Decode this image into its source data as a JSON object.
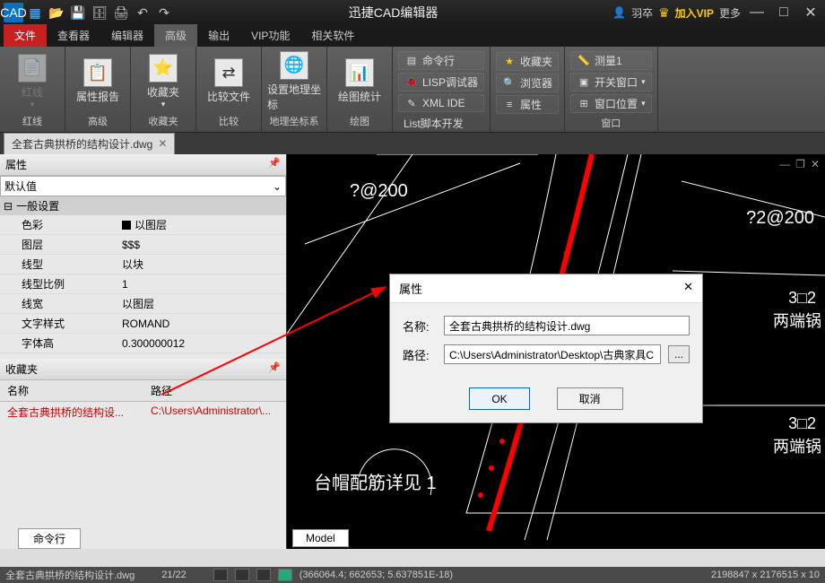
{
  "titlebar": {
    "app_title": "迅捷CAD编辑器",
    "user": "羽卒",
    "vip": "加入VIP",
    "more": "更多"
  },
  "tabs": [
    "文件",
    "查看器",
    "编辑器",
    "高级",
    "输出",
    "VIP功能",
    "相关软件"
  ],
  "ribbon": {
    "g1": {
      "btn": "红线",
      "drop": "▾",
      "label": "红线"
    },
    "g2": {
      "btn": "属性报告",
      "label": "高级"
    },
    "g3": {
      "btn": "收藏夹",
      "drop": "▾",
      "label": "收藏夹"
    },
    "g4": {
      "btn": "比较文件",
      "label": "比较"
    },
    "g5": {
      "btn": "设置地理坐标",
      "label": "地理坐标系"
    },
    "g6": {
      "btn": "绘图统计",
      "label": "绘图"
    },
    "g7": {
      "items": [
        "命令行",
        "LISP调试器",
        "XML IDE",
        "List脚本开发"
      ],
      "label": ""
    },
    "g8": {
      "items": [
        "收藏夹",
        "浏览器",
        "属性"
      ],
      "label": ""
    },
    "g9": {
      "items": [
        "测量1",
        "开关窗口",
        "窗口位置"
      ],
      "label": "窗口"
    }
  },
  "doctab": {
    "name": "全套古典拱桥的结构设计.dwg"
  },
  "prop_panel": {
    "title": "属性",
    "default": "默认值",
    "cat": "一般设置",
    "rows": [
      {
        "k": "色彩",
        "v": "以图层",
        "swatch": true
      },
      {
        "k": "图层",
        "v": "$$$"
      },
      {
        "k": "线型",
        "v": "以块"
      },
      {
        "k": "线型比例",
        "v": "1"
      },
      {
        "k": "线宽",
        "v": "以图层"
      },
      {
        "k": "文字样式",
        "v": "ROMAND"
      },
      {
        "k": "字体高",
        "v": "0.300000012"
      }
    ]
  },
  "fav_panel": {
    "title": "收藏夹",
    "cols": [
      "名称",
      "路径"
    ],
    "row": {
      "name": "全套古典拱桥的结构设...",
      "path": "C:\\Users\\Administrator\\..."
    }
  },
  "cmdline_tab": "命令行",
  "canvas": {
    "t1": "?@200",
    "t2": "?2@200",
    "t3": "3□2",
    "t4": "两端锅",
    "t5": "3□2",
    "t6": "两端锅",
    "t7": "台帽配筋详见 1",
    "model": "Model"
  },
  "dialog": {
    "title": "属性",
    "name_lbl": "名称:",
    "path_lbl": "路径:",
    "name_val": "全套古典拱桥的结构设计.dwg",
    "path_val": "C:\\Users\\Administrator\\Desktop\\古典家具C",
    "ok": "OK",
    "cancel": "取消",
    "close": "✕",
    "dots": "..."
  },
  "status": {
    "file": "全套古典拱桥的结构设计.dwg",
    "pages": "21/22",
    "coords": "(366064.4; 662653; 5.637851E-18)",
    "extent": "2198847 x 2176515 x 10"
  }
}
